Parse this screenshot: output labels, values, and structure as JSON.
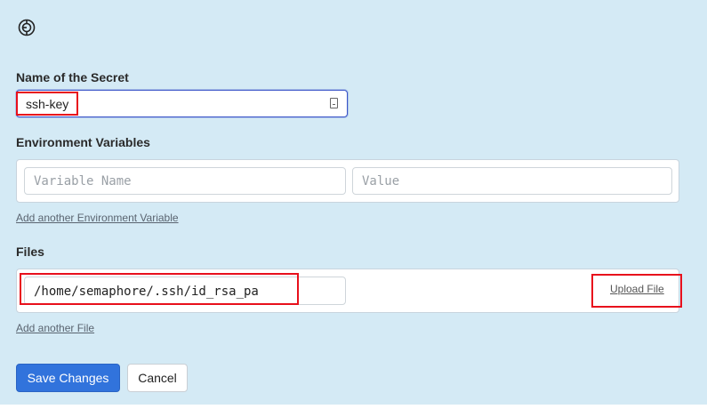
{
  "logo": {
    "icon": "semaphore-logo-icon"
  },
  "secret_name": {
    "label": "Name of the Secret",
    "value": "ssh-key"
  },
  "env_vars": {
    "label": "Environment Variables",
    "name_placeholder": "Variable Name",
    "value_placeholder": "Value",
    "add_link": "Add another Environment Variable"
  },
  "files": {
    "label": "Files",
    "path_value": "/home/semaphore/.ssh/id_rsa_pa",
    "upload_label": "Upload File",
    "add_link": "Add another File"
  },
  "actions": {
    "save_label": "Save Changes",
    "cancel_label": "Cancel"
  },
  "colors": {
    "panel_bg": "#d4eaf5",
    "primary": "#3173dc",
    "highlight": "#e8101c"
  }
}
